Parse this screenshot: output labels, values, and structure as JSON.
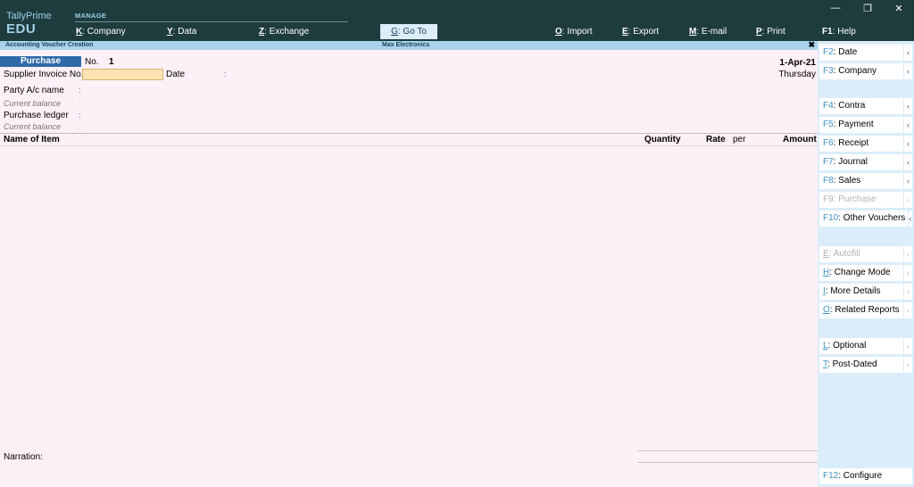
{
  "app": {
    "brand_line1": "TallyPrime",
    "brand_line2": "EDU",
    "section": "MANAGE"
  },
  "topmenu": [
    {
      "key": "K",
      "label": "Company"
    },
    {
      "key": "Y",
      "label": "Data"
    },
    {
      "key": "Z",
      "label": "Exchange"
    },
    {
      "key": "G",
      "label": "Go To"
    },
    {
      "key": "O",
      "label": "Import"
    },
    {
      "key": "E",
      "label": "Export"
    },
    {
      "key": "M",
      "label": "E-mail"
    },
    {
      "key": "P",
      "label": "Print"
    },
    {
      "key": "F1",
      "label": "Help"
    }
  ],
  "window_controls": {
    "minimize": "—",
    "restore": "❐",
    "close": "✕"
  },
  "titlebar": {
    "screen": "Accounting Voucher Creation",
    "company": "Max Electronics",
    "close": "✖"
  },
  "voucher": {
    "type": "Purchase",
    "no_label": "No.",
    "no_value": "1",
    "date": "1-Apr-21",
    "day": "Thursday",
    "supplier_invoice_label": "Supplier Invoice No.:",
    "supplier_invoice_value": "",
    "date_label": "Date",
    "colon": ":",
    "party_label": "Party A/c name",
    "current_balance_label": "Current balance",
    "purchase_ledger_label": "Purchase ledger",
    "columns": {
      "name": "Name of Item",
      "quantity": "Quantity",
      "rate": "Rate",
      "per": "per",
      "amount": "Amount"
    },
    "narration_label": "Narration:"
  },
  "sidebar": [
    {
      "key": "F2",
      "label": "Date",
      "enabled": true,
      "arrow": true
    },
    {
      "key": "F3",
      "label": "Company",
      "enabled": true,
      "arrow": true
    },
    {
      "key": "F4",
      "label": "Contra",
      "enabled": true,
      "arrow": true
    },
    {
      "key": "F5",
      "label": "Payment",
      "enabled": true,
      "arrow": true
    },
    {
      "key": "F6",
      "label": "Receipt",
      "enabled": true,
      "arrow": true
    },
    {
      "key": "F7",
      "label": "Journal",
      "enabled": true,
      "arrow": true
    },
    {
      "key": "F8",
      "label": "Sales",
      "enabled": true,
      "arrow": true
    },
    {
      "key": "F9",
      "label": "Purchase",
      "enabled": false,
      "arrow": true
    },
    {
      "key": "F10",
      "label": "Other Vouchers",
      "enabled": true,
      "arrow": true
    },
    {
      "key": "E",
      "label": "Autofill",
      "enabled": false,
      "arrow": true
    },
    {
      "key": "H",
      "label": "Change Mode",
      "enabled": true,
      "arrow": true
    },
    {
      "key": "I",
      "label": "More Details",
      "enabled": true,
      "arrow": true
    },
    {
      "key": "O",
      "label": "Related Reports",
      "enabled": true,
      "arrow": true
    },
    {
      "key": "L",
      "label": "Optional",
      "enabled": true,
      "arrow": true
    },
    {
      "key": "T",
      "label": "Post-Dated",
      "enabled": true,
      "arrow": true
    },
    {
      "key": "F12",
      "label": "Configure",
      "enabled": true,
      "arrow": false
    }
  ],
  "arrow_glyph": "‹",
  "colors": {
    "topbar": "#1e3b3e",
    "accent": "#2f6aa8",
    "panel": "#dbedfa",
    "canvas": "#fdf1f7"
  }
}
